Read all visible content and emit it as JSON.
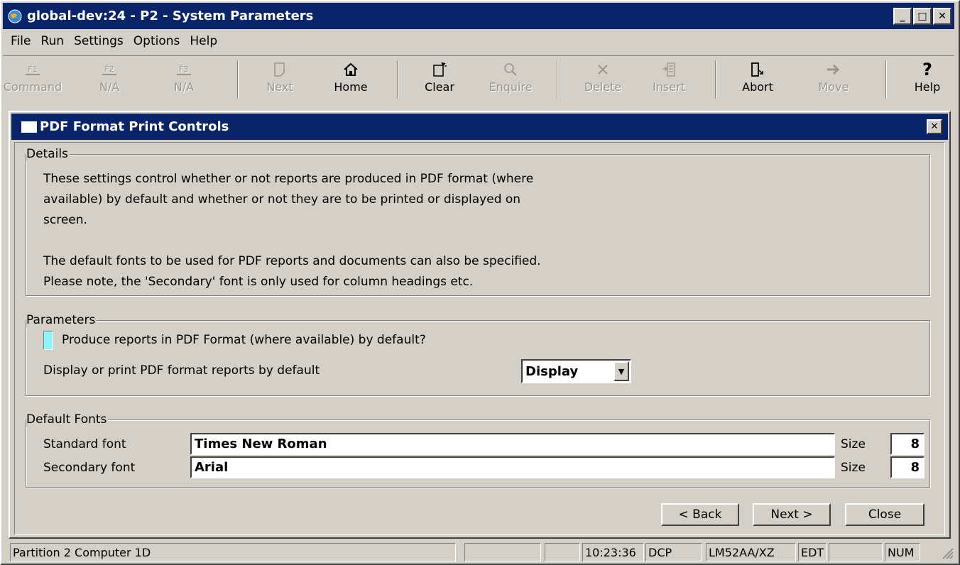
{
  "window": {
    "title": "global-dev:24 - P2 - System Parameters",
    "controls": [
      "minimize",
      "maximize",
      "close"
    ]
  },
  "menu": [
    "File",
    "Run",
    "Settings",
    "Options",
    "Help"
  ],
  "toolbar": [
    {
      "label": "Command",
      "icon": "f1-key-icon",
      "enabled": false
    },
    {
      "label": "N/A",
      "icon": "f2-key-icon",
      "enabled": false
    },
    {
      "label": "N/A",
      "icon": "f3-key-icon",
      "enabled": false
    },
    {
      "label": "Next",
      "icon": "next-page-icon",
      "enabled": false
    },
    {
      "label": "Home",
      "icon": "home-icon",
      "enabled": true
    },
    {
      "label": "Clear",
      "icon": "clear-icon",
      "enabled": true
    },
    {
      "label": "Enquire",
      "icon": "magnifier-icon",
      "enabled": false
    },
    {
      "label": "Delete",
      "icon": "delete-x-icon",
      "enabled": false
    },
    {
      "label": "Insert",
      "icon": "insert-icon",
      "enabled": false
    },
    {
      "label": "Abort",
      "icon": "exit-door-icon",
      "enabled": true
    },
    {
      "label": "Move",
      "icon": "arrow-right-icon",
      "enabled": false
    },
    {
      "label": "Help",
      "icon": "question-icon",
      "enabled": true
    }
  ],
  "dialog": {
    "title": "PDF Format Print Controls",
    "details": {
      "legend": "Details",
      "para1_line1": "These settings control whether or not reports are produced in PDF format (where",
      "para1_line2": "available) by default and whether or not they are to be printed or displayed on",
      "para1_line3": "screen.",
      "para2_line1": "The default fonts to be used for PDF reports and documents can also be specified.",
      "para2_line2": "Please note, the 'Secondary' font is only used for column headings etc."
    },
    "parameters": {
      "legend": "Parameters",
      "pdf_default_label": "Produce reports in PDF Format (where available) by default?",
      "pdf_default_checked": false,
      "display_print_label": "Display or print PDF format reports by default",
      "display_print_value": "Display"
    },
    "fonts": {
      "legend": "Default Fonts",
      "standard_label": "Standard font",
      "standard_value": "Times New Roman",
      "standard_size_label": "Size",
      "standard_size": "8",
      "secondary_label": "Secondary font",
      "secondary_value": "Arial",
      "secondary_size_label": "Size",
      "secondary_size": "8"
    },
    "buttons": {
      "back": "< Back",
      "next": "Next >",
      "close": "Close"
    }
  },
  "statusbar": {
    "partition": "Partition 2 Computer 1D",
    "time": "10:23:36",
    "mode": "DCP",
    "code": "LM52AA/XZ",
    "edit": "EDT",
    "numlock": "NUM"
  }
}
